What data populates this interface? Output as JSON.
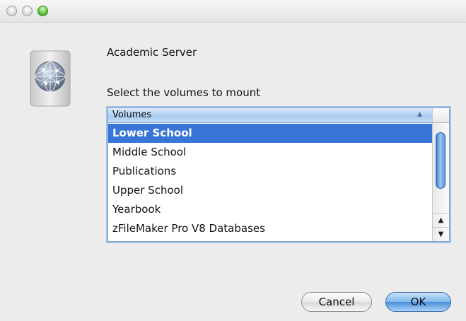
{
  "window": {
    "controls": [
      "close",
      "minimize",
      "zoom"
    ]
  },
  "server": {
    "name": "Academic Server",
    "icon": "network-server-globe-icon"
  },
  "prompt": "Select the volumes to mount",
  "volumes_list": {
    "column_header": "Volumes",
    "sort_indicator": "▲",
    "items": [
      {
        "label": "Lower School",
        "selected": true
      },
      {
        "label": "Middle School",
        "selected": false
      },
      {
        "label": "Publications",
        "selected": false
      },
      {
        "label": "Upper School",
        "selected": false
      },
      {
        "label": "Yearbook",
        "selected": false
      },
      {
        "label": "zFileMaker Pro V8 Databases",
        "selected": false
      }
    ],
    "scroll_up_glyph": "▲",
    "scroll_down_glyph": "▼"
  },
  "buttons": {
    "cancel": "Cancel",
    "ok": "OK"
  },
  "colors": {
    "selection": "#3875d7",
    "default_button": "#4a8fdc",
    "window_bg": "#ececec"
  }
}
